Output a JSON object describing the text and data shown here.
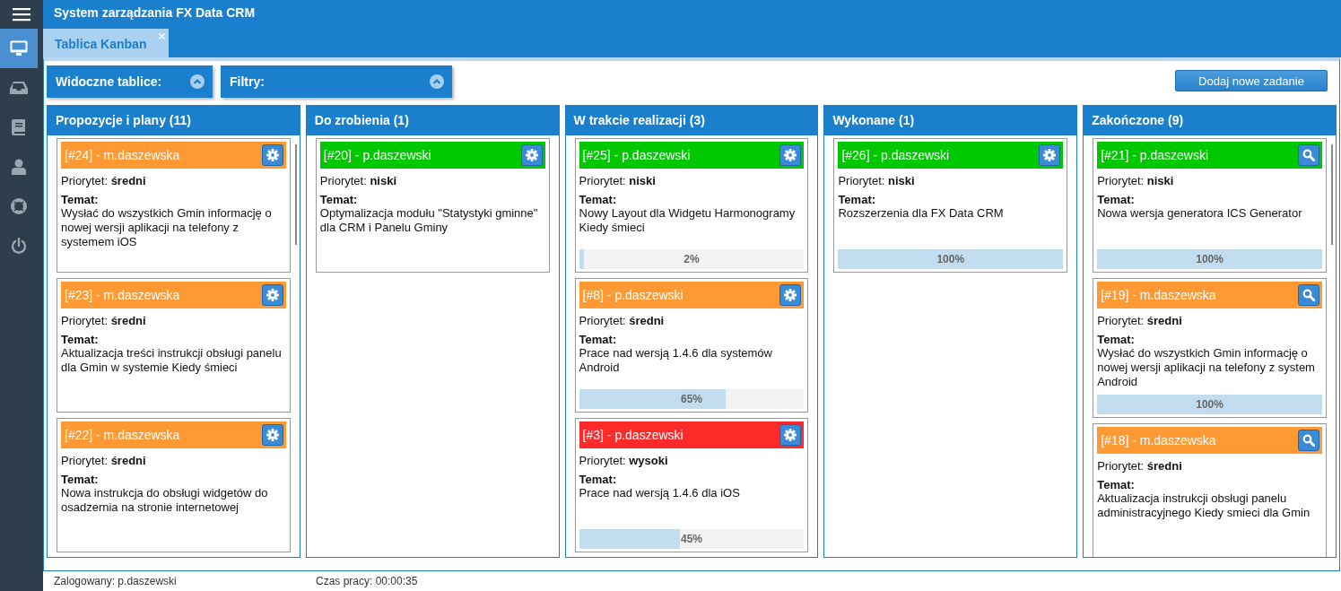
{
  "app": {
    "title": "System zarządzania FX Data CRM"
  },
  "sidebar": {
    "items": [
      {
        "selected": true
      },
      {
        "selected": false
      },
      {
        "selected": false
      },
      {
        "selected": false
      },
      {
        "selected": false
      },
      {
        "selected": false
      }
    ]
  },
  "tabs": [
    {
      "label": "Tablica Kanban",
      "selected": true,
      "closable": true
    }
  ],
  "toolbar": {
    "panels": [
      {
        "label": "Widoczne tablice:"
      },
      {
        "label": "Filtry:"
      }
    ],
    "add_button": "Dodaj nowe zadanie"
  },
  "columns": [
    {
      "title": "Propozycje i plany (11)",
      "scrollable": true,
      "cards": [
        {
          "header": "[#24] - m.daszewska",
          "color": "#ff9933",
          "kind": "editable",
          "priority_label": "Priorytet:",
          "priority": "średni",
          "topic_label": "Temat:",
          "topic": "Wysłać do wszystkich Gmin informację o nowej wersji aplikacji na telefony z systemem iOS"
        },
        {
          "header": "[#23] - m.daszewska",
          "color": "#ff9933",
          "kind": "editable",
          "priority_label": "Priorytet:",
          "priority": "średni",
          "topic_label": "Temat:",
          "topic": "Aktualizacja treści instrukcji obsługi panelu dla Gmin w systemie Kiedy śmieci"
        },
        {
          "header": "[#22] - m.daszewska",
          "color": "#ff9933",
          "kind": "editable",
          "priority_label": "Priorytet:",
          "priority": "średni",
          "topic_label": "Temat:",
          "topic": "Nowa instrukcja do obsługi widgetów do osadzernia na stronie internetowej"
        }
      ]
    },
    {
      "title": "Do zrobienia (1)",
      "scrollable": false,
      "cards": [
        {
          "header": "[#20] - p.daszewski",
          "color": "#00c800",
          "kind": "editable",
          "priority_label": "Priorytet:",
          "priority": "niski",
          "topic_label": "Temat:",
          "topic": "Optymalizacja modułu \"Statystyki gminne\" dla CRM i Panelu Gminy"
        }
      ]
    },
    {
      "title": "W trakcie realizacji (3)",
      "scrollable": false,
      "cards": [
        {
          "header": "[#25] - p.daszewski",
          "color": "#00c800",
          "kind": "editable",
          "priority_label": "Priorytet:",
          "priority": "niski",
          "topic_label": "Temat:",
          "topic": "Nowy Layout dla Widgetu Harmonogramy Kiedy śmieci",
          "progress": {
            "level": 0.02,
            "reading": "2%"
          }
        },
        {
          "header": "[#8] - p.daszewski",
          "color": "#ff9933",
          "kind": "editable",
          "priority_label": "Priorytet:",
          "priority": "średni",
          "topic_label": "Temat:",
          "topic": "Prace nad wersją 1.4.6 dla systemów Android",
          "progress": {
            "level": 0.65,
            "reading": "65%"
          }
        },
        {
          "header": "[#3] - p.daszewski",
          "color": "#ff2b2b",
          "kind": "editable",
          "priority_label": "Priorytet:",
          "priority": "wysoki",
          "topic_label": "Temat:",
          "topic": "Prace nad wersją 1.4.6 dla iOS",
          "progress": {
            "level": 0.45,
            "reading": "45%"
          }
        }
      ]
    },
    {
      "title": "Wykonane (1)",
      "scrollable": false,
      "cards": [
        {
          "header": "[#26] - p.daszewski",
          "color": "#00c800",
          "kind": "editable",
          "priority_label": "Priorytet:",
          "priority": "niski",
          "topic_label": "Temat:",
          "topic": "Rozszerzenia dla FX Data CRM",
          "progress": {
            "level": 1,
            "reading": "100%"
          }
        }
      ]
    },
    {
      "title": "Zakończone (9)",
      "scrollable": true,
      "cards": [
        {
          "header": "[#21] - p.daszewski",
          "color": "#00c800",
          "kind": "readonly",
          "priority_label": "Priorytet:",
          "priority": "niski",
          "topic_label": "Temat:",
          "topic": "Nowa wersja generatora ICS Generator",
          "progress": {
            "level": 1,
            "reading": "100%"
          }
        },
        {
          "header": "[#19] - m.daszewska",
          "color": "#ff9933",
          "kind": "readonly",
          "priority_label": "Priorytet:",
          "priority": "średni",
          "topic_label": "Temat:",
          "topic": "Wysłać do wszystkich Gmin informację o nowej wersji aplikacji na telefony z system Android",
          "progress": {
            "level": 1,
            "reading": "100%"
          }
        },
        {
          "header": "[#18] - m.daszewska",
          "color": "#ff9933",
          "kind": "readonly",
          "priority_label": "Priorytet:",
          "priority": "średni",
          "topic_label": "Temat:",
          "topic": "Aktualizacja instrukcji obsługi panelu administracyjnego Kiedy smieci dla Gmin"
        }
      ]
    }
  ],
  "status_bar": {
    "user": "Zalogowany: p.daszewski",
    "time": "Czas pracy: 00:00:35"
  }
}
